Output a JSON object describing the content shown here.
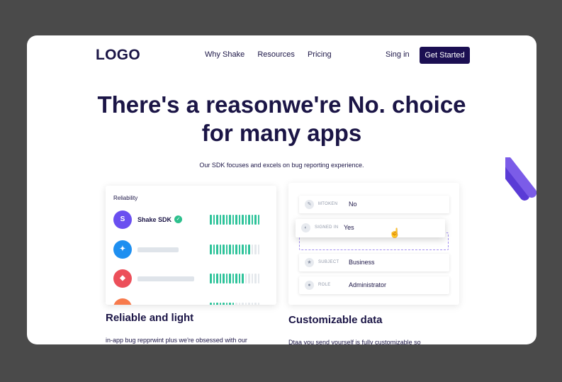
{
  "nav": {
    "logo": "LOGO",
    "links": [
      "Why Shake",
      "Resources",
      "Pricing"
    ],
    "signin": "Sing in",
    "cta": "Get Started"
  },
  "hero": {
    "line1": "There's a reasonwe're No. choice",
    "line2": "for many apps",
    "subtitle": "Our SDK focuses and excels on bug reporting experience."
  },
  "reliability": {
    "title": "Reliability",
    "rows": [
      {
        "name": "Shake SDK",
        "avatar_color": "#6a4ff0",
        "level": 1.0
      },
      {
        "name": "",
        "avatar_color": "#1e8ff0",
        "level": 0.8
      },
      {
        "name": "",
        "avatar_color": "#ec4f5a",
        "level": 0.7
      },
      {
        "name": "",
        "avatar_color": "#f77a4c",
        "level": 0.5
      }
    ]
  },
  "custom_data": {
    "fields": [
      {
        "label": "MTOKEN",
        "value": "No",
        "icon": "wrench-icon"
      },
      {
        "label": "SIGNED IN",
        "value": "Yes",
        "icon": "toggle-icon"
      },
      {
        "label": "SUBJECT",
        "value": "Business",
        "icon": "star-icon"
      },
      {
        "label": "ROLE",
        "value": "Administrator",
        "icon": "person-icon"
      }
    ]
  },
  "features": [
    {
      "title": "Reliable and light",
      "text": "in-app bug repprwint plus we're obsessed with our"
    },
    {
      "title": "Customizable data",
      "text": "Dtaa you send yourself is fully customizable so"
    }
  ],
  "colors": {
    "brand": "#1b1546",
    "accent": "#1b0f52",
    "green": "#2ec39a"
  }
}
